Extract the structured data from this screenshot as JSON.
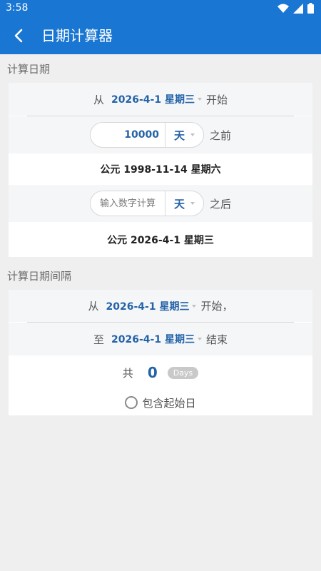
{
  "status": {
    "time": "3:58"
  },
  "app_bar": {
    "title": "日期计算器"
  },
  "section1": {
    "label": "计算日期",
    "from_prefix": "从",
    "from_date": "2026-4-1 星期三",
    "from_suffix": "开始",
    "before": {
      "value": "10000",
      "unit": "天",
      "suffix": "之前",
      "result": "公元 1998-11-14 星期六"
    },
    "after": {
      "placeholder": "输入数字计算",
      "unit": "天",
      "suffix": "之后",
      "result": "公元 2026-4-1 星期三"
    }
  },
  "section2": {
    "label": "计算日期间隔",
    "from_prefix": "从",
    "from_date": "2026-4-1 星期三",
    "from_suffix": "开始，",
    "to_prefix": "至",
    "to_date": "2026-4-1 星期三",
    "to_suffix": "结束",
    "total_prefix": "共",
    "count": "0",
    "unit_badge": "Days",
    "include_start_label": "包含起始日"
  },
  "colors": {
    "primary": "#1976d2",
    "accent_text": "#2563a8",
    "background": "#efefef"
  }
}
